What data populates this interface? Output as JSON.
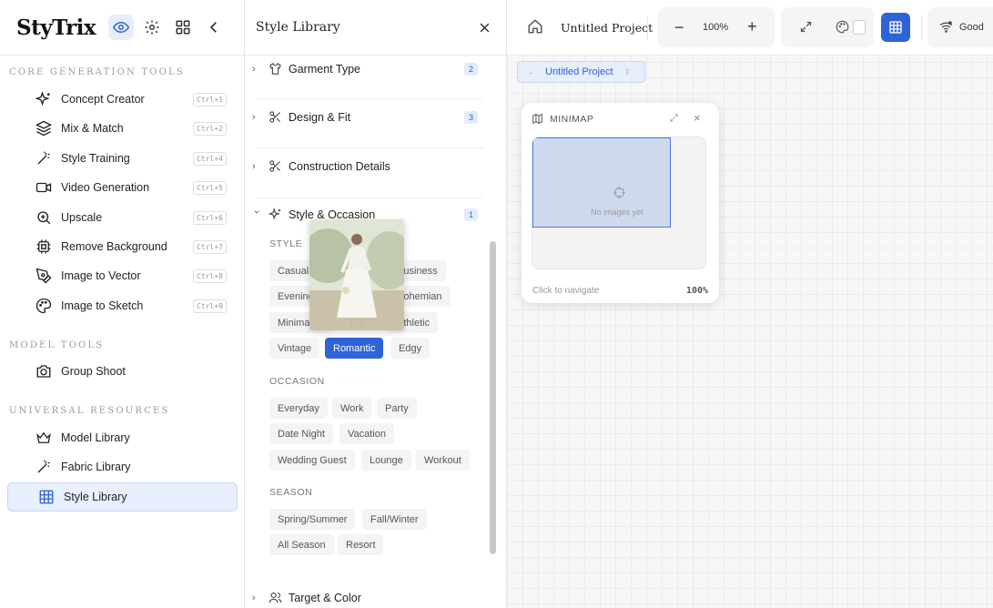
{
  "app": {
    "logo": "StyTrix"
  },
  "sidebar": {
    "sections": {
      "core": "CORE GENERATION TOOLS",
      "model": "MODEL TOOLS",
      "universal": "UNIVERSAL RESOURCES"
    },
    "core_items": [
      {
        "label": "Concept Creator",
        "shortcut": "Ctrl+1",
        "icon": "sparkles-icon"
      },
      {
        "label": "Mix & Match",
        "shortcut": "Ctrl+2",
        "icon": "layers-icon"
      },
      {
        "label": "Style Training",
        "shortcut": "Ctrl+4",
        "icon": "wand-icon"
      },
      {
        "label": "Video Generation",
        "shortcut": "Ctrl+5",
        "icon": "video-icon"
      },
      {
        "label": "Upscale",
        "shortcut": "Ctrl+6",
        "icon": "zoom-in-icon"
      },
      {
        "label": "Remove Background",
        "shortcut": "Ctrl+7",
        "icon": "chip-icon"
      },
      {
        "label": "Image to Vector",
        "shortcut": "Ctrl+8",
        "icon": "pen-tool-icon"
      },
      {
        "label": "Image to Sketch",
        "shortcut": "Ctrl+9",
        "icon": "palette-icon"
      }
    ],
    "model_items": [
      {
        "label": "Group Shoot",
        "icon": "camera-icon"
      }
    ],
    "universal_items": [
      {
        "label": "Model Library",
        "icon": "crown-icon"
      },
      {
        "label": "Fabric Library",
        "icon": "wand-icon"
      },
      {
        "label": "Style Library",
        "icon": "grid-icon"
      }
    ]
  },
  "library": {
    "title": "Style Library",
    "accordions": [
      {
        "label": "Garment Type",
        "count": "2",
        "icon": "shirt-icon"
      },
      {
        "label": "Design & Fit",
        "count": "3",
        "icon": "scissors-icon"
      },
      {
        "label": "Construction Details",
        "count": "",
        "icon": "scissors-icon"
      },
      {
        "label": "Style & Occasion",
        "count": "1",
        "icon": "sparkles-icon"
      },
      {
        "label": "Target & Color",
        "count": "",
        "icon": "users-icon"
      }
    ],
    "groups": {
      "style": "STYLE",
      "occasion": "OCCASION",
      "season": "SEASON"
    },
    "style_chips": [
      "Casual",
      "Business",
      "Evening",
      "Bohemian",
      "Minimalist",
      "Athletic",
      "Vintage",
      "Romantic",
      "Edgy"
    ],
    "occasion_chips": [
      "Everyday",
      "Work",
      "Party",
      "Date Night",
      "Vacation",
      "Wedding Guest",
      "Lounge",
      "Workout"
    ],
    "season_chips": [
      "Spring/Summer",
      "Fall/Winter",
      "All Season",
      "Resort"
    ],
    "selected_chip": "Romantic"
  },
  "canvas": {
    "project_title": "Untitled Project",
    "zoom": "100%",
    "connection": "Good",
    "tab_label": "Untitled Project",
    "minimap": {
      "title": "MINIMAP",
      "empty_text": "No images yet",
      "hint": "Click to navigate",
      "zoom": "100%"
    }
  },
  "colors": {
    "accent": "#2f63d8",
    "accent_light": "#e6edfb"
  }
}
